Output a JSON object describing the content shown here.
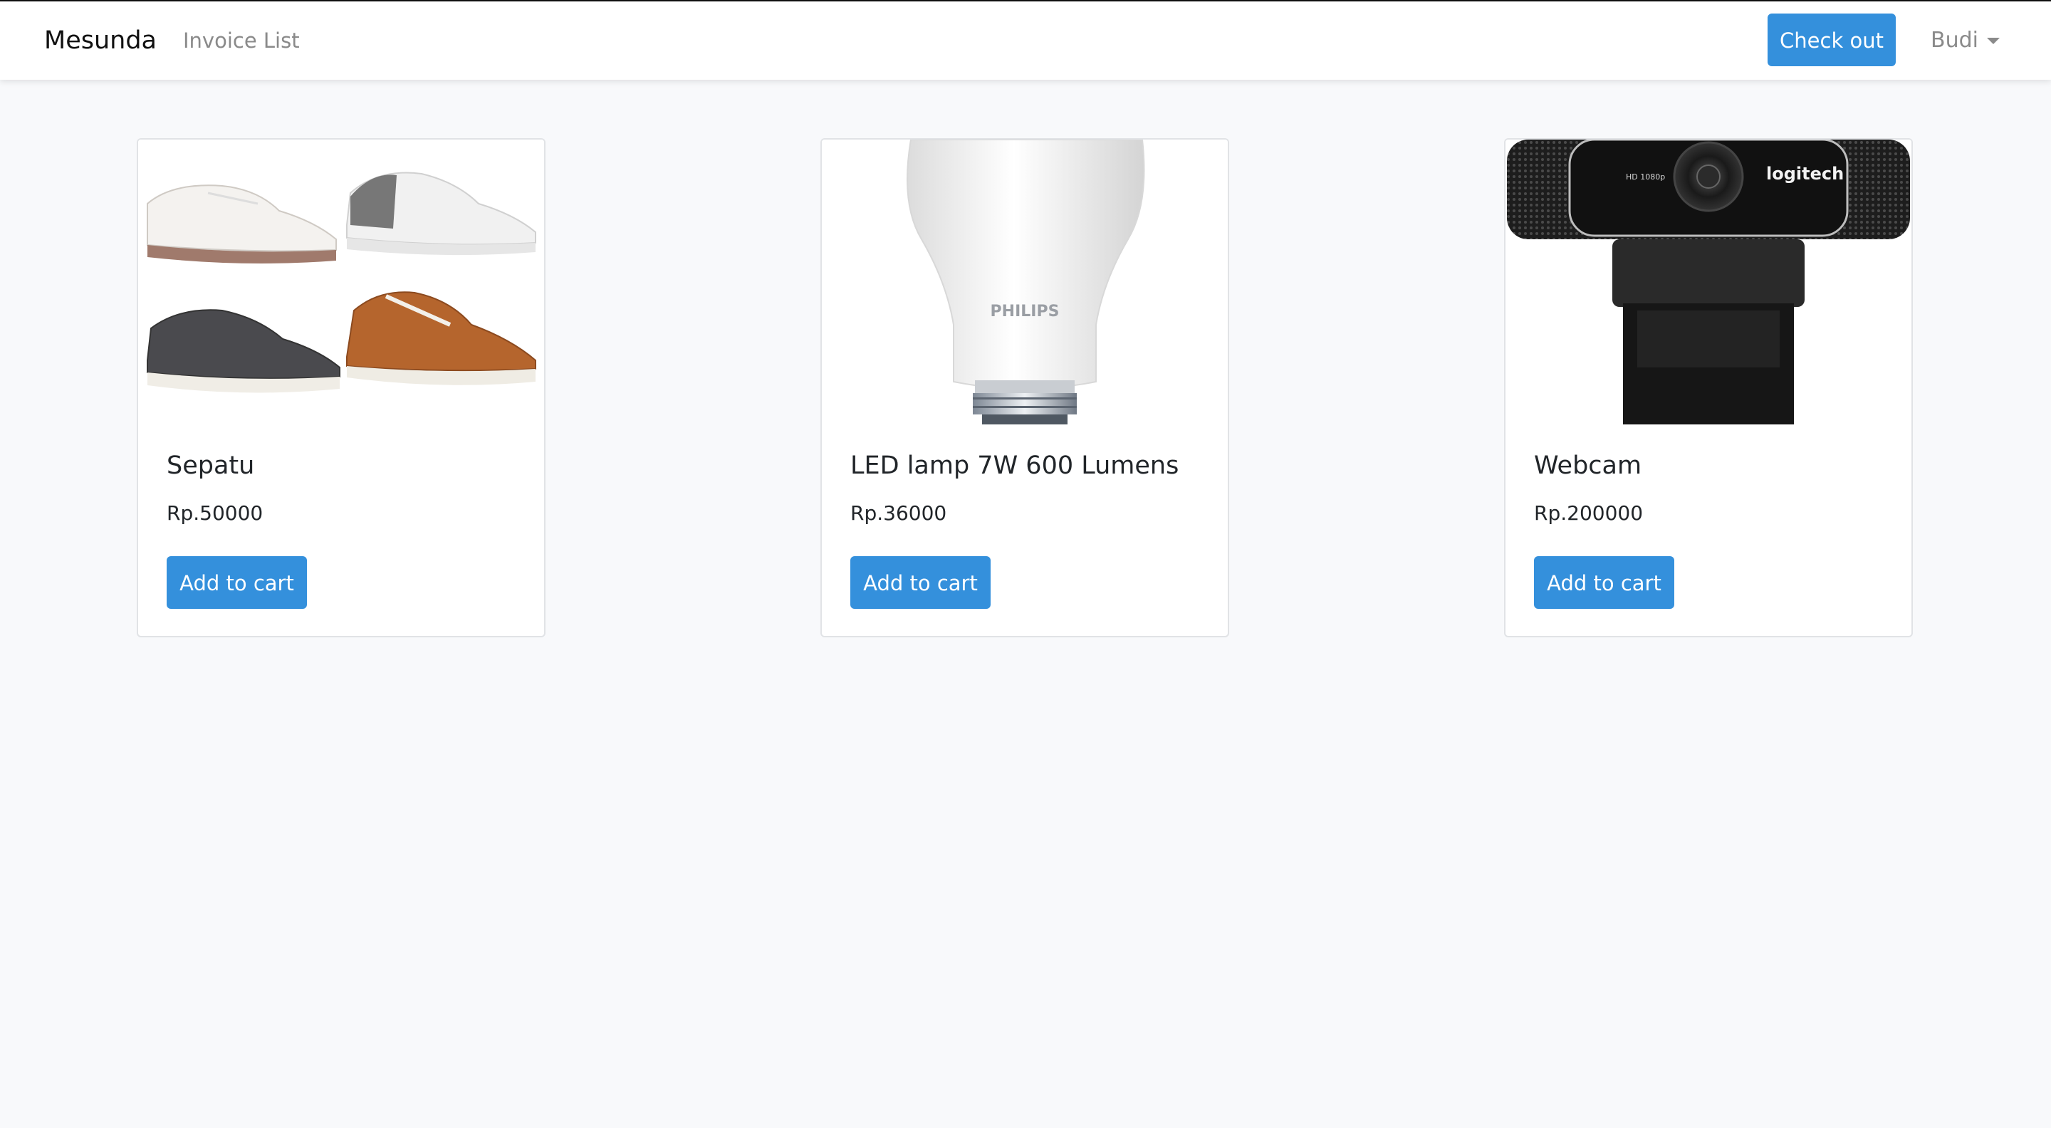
{
  "navbar": {
    "brand": "Mesunda",
    "nav_link": "Invoice List",
    "checkout_label": "Check out",
    "user_name": "Budi"
  },
  "products": [
    {
      "title": "Sepatu",
      "price": "Rp.50000",
      "button_label": "Add to cart",
      "image_icon": "sneakers-image"
    },
    {
      "title": "LED lamp 7W 600 Lumens",
      "price": "Rp.36000",
      "button_label": "Add to cart",
      "image_icon": "light-bulb-image",
      "image_text": "PHILIPS"
    },
    {
      "title": "Webcam",
      "price": "Rp.200000",
      "button_label": "Add to cart",
      "image_icon": "webcam-image",
      "image_text": [
        "HD 1080p",
        "logitech"
      ]
    }
  ],
  "colors": {
    "accent": "#3490dc",
    "background": "#f8f9fb"
  }
}
